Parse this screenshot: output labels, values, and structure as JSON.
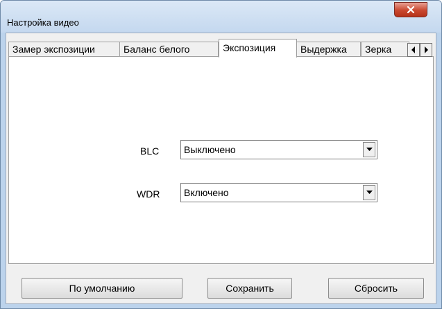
{
  "window": {
    "title": "Настройка видео",
    "close_icon": "close-icon"
  },
  "tabs": [
    {
      "label": "Замер экспозиции",
      "active": false
    },
    {
      "label": "Баланс белого",
      "active": false
    },
    {
      "label": "Экспозиция",
      "active": true
    },
    {
      "label": "Выдержка",
      "active": false
    },
    {
      "label": "Зерка",
      "active": false
    }
  ],
  "tab_scroll": {
    "left_icon": "arrow-left-icon",
    "right_icon": "arrow-right-icon"
  },
  "settings": {
    "blc": {
      "label": "BLC",
      "value": "Выключено"
    },
    "wdr": {
      "label": "WDR",
      "value": "Включено"
    }
  },
  "buttons": {
    "default": "По умолчанию",
    "save": "Сохранить",
    "reset": "Сбросить"
  },
  "colors": {
    "window_frame": "#bcd3ec",
    "close_button": "#c9482f",
    "panel": "#ffffff",
    "dialog_bg": "#f0f0f0"
  }
}
